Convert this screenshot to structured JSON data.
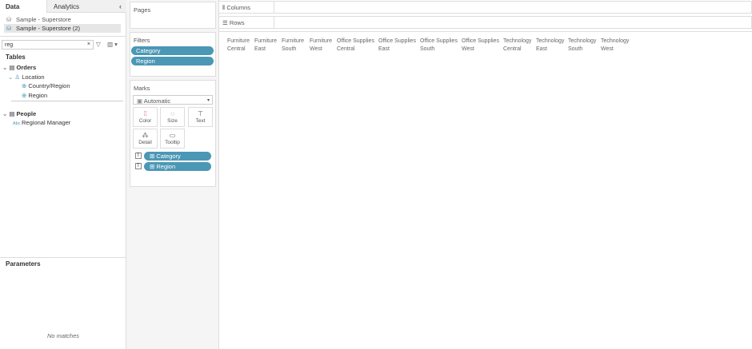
{
  "tabs": {
    "data": "Data",
    "analytics": "Analytics"
  },
  "datasources": [
    "Sample - Superstore",
    "Sample - Superstore (2)"
  ],
  "search": {
    "value": "reg"
  },
  "tables_label": "Tables",
  "tree": {
    "orders": "Orders",
    "location": "Location",
    "country": "Country/Region",
    "region": "Region",
    "people": "People",
    "manager": "Regional Manager"
  },
  "parameters": {
    "title": "Parameters",
    "empty": "No matches"
  },
  "pages": "Pages",
  "filters": {
    "title": "Filters",
    "items": [
      "Category",
      "Region"
    ]
  },
  "marks": {
    "title": "Marks",
    "type": "Automatic",
    "cards": [
      "Color",
      "Size",
      "Text",
      "Detail",
      "Tooltip"
    ],
    "fields": [
      "Category",
      "Region"
    ]
  },
  "shelves": {
    "columns": "Columns",
    "rows": "Rows"
  },
  "headers": [
    [
      "Furniture",
      "Central"
    ],
    [
      "Furniture",
      "East"
    ],
    [
      "Furniture",
      "South"
    ],
    [
      "Furniture",
      "West"
    ],
    [
      "Office Supplies",
      "Central"
    ],
    [
      "Office Supplies",
      "East"
    ],
    [
      "Office Supplies",
      "South"
    ],
    [
      "Office Supplies",
      "West"
    ],
    [
      "Technology",
      "Central"
    ],
    [
      "Technology",
      "East"
    ],
    [
      "Technology",
      "South"
    ],
    [
      "Technology",
      "West"
    ]
  ]
}
